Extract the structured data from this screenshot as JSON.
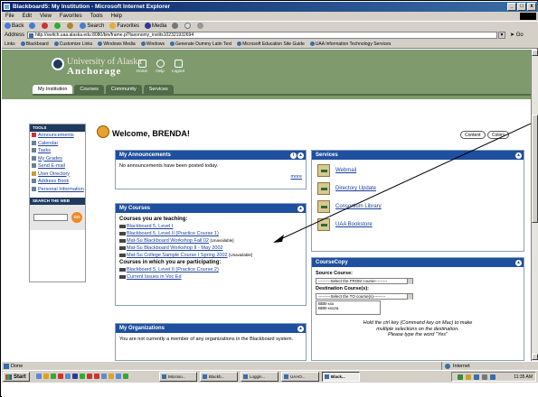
{
  "window": {
    "title": "Blackboard5: My Institution - Microsoft Internet Explorer",
    "min": "_",
    "max": "□",
    "close": "x"
  },
  "menu": [
    "File",
    "Edit",
    "View",
    "Favorites",
    "Tools",
    "Help"
  ],
  "toolbar": {
    "back": "Back",
    "search": "Search",
    "favorites": "Favorites",
    "media": "Media"
  },
  "address": {
    "label": "Address",
    "url": "http://switch.uaa.alaska.edu:8080/bin/frame.pl?taxonomy_instits102321932694",
    "go": "Go"
  },
  "links": {
    "label": "Links",
    "items": [
      "Blackboard",
      "Customize Links",
      "Windows Media",
      "Windows",
      "Generate Dummy Latin Text",
      "Microsoft Education Site Guide",
      "UAA Information Technology Services"
    ]
  },
  "banner": {
    "uni": "University of Alaska",
    "anc": "Anchorage",
    "icons": [
      {
        "label": "Home",
        "icon": "home-icon"
      },
      {
        "label": "Help",
        "icon": "help-icon"
      },
      {
        "label": "Logout",
        "icon": "logout-icon"
      }
    ],
    "tabs": [
      "My Institution",
      "Courses",
      "Community",
      "Services"
    ]
  },
  "tools": {
    "header": "TOOLS",
    "items": [
      "Announcements",
      "Calendar",
      "Tasks",
      "My Grades",
      "Send E-mail",
      "User Directory",
      "Address Book",
      "Personal Information"
    ],
    "search_header": "SEARCH THE WEB",
    "go": "GO"
  },
  "welcome": {
    "text": "Welcome, BRENDA!",
    "content_btn": "Content",
    "colors_btn": "Colors"
  },
  "announcements": {
    "title": "My Announcements",
    "body": "No announcements have been posted today.",
    "more": "more"
  },
  "courses": {
    "title": "My Courses",
    "teaching_label": "Courses you are teaching:",
    "teaching": [
      {
        "name": "Blackboard 5, Level I",
        "note": ""
      },
      {
        "name": "Blackboard 5, Level II (Practice Course 1)",
        "note": ""
      },
      {
        "name": "Mat-Su Blackboard Workshop Fall 02",
        "note": "[Unavailable]"
      },
      {
        "name": "Mat-Su Blackboard Workshop II - May 2002",
        "note": ""
      },
      {
        "name": "Mat-Su College Sample Course I Spring 2002",
        "note": "[Unavailable]"
      }
    ],
    "participating_label": "Courses in which you are participating:",
    "participating": [
      {
        "name": "Blackboard 5, Level II (Practice Course 2)",
        "note": ""
      },
      {
        "name": "Current Issues in Voc Ed",
        "note": ""
      }
    ]
  },
  "organizations": {
    "title": "My Organizations",
    "body": "You are not currently a member of any organizations in the Blackboard system."
  },
  "services": {
    "title": "Services",
    "items": [
      "Webmail",
      "Directory Update",
      "Consortium Library",
      "UAA Bookstore"
    ]
  },
  "coursecopy": {
    "title": "CourseCopy",
    "source_label": "Source Course:",
    "source_select": "---------Select the FROM course---------",
    "dest_label": "Destination Course(s):",
    "dest_select": "---------Select the TO course(s)---------",
    "dest_options": [
      "BBB-xxx",
      "BBB-xxx2a"
    ],
    "hint1": "Hold the ctrl key (Command key on Mac) to make",
    "hint2": "multiple selections on the destination.",
    "hint3": "Please type the word \"Yes\""
  },
  "status": {
    "left": "Done",
    "zone": "Internet"
  },
  "taskbar": {
    "start": "Start",
    "buttons": [
      "Microso...",
      "Blackb...",
      "Loggin...",
      "UAAO...",
      "Black..."
    ],
    "clock": "11:35 AM"
  }
}
